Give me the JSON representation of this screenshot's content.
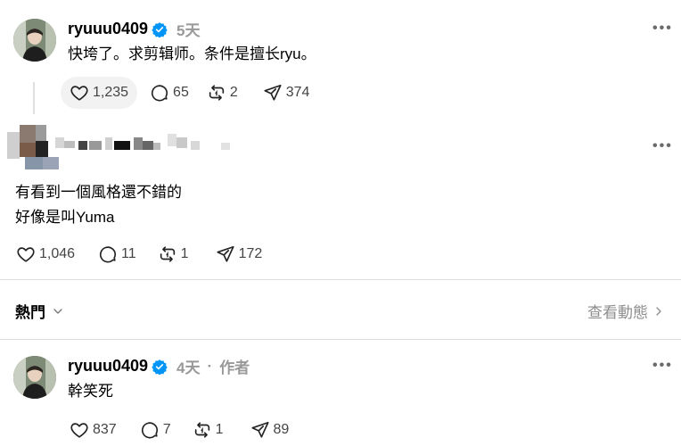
{
  "post1": {
    "username": "ryuuu0409",
    "time": "5天",
    "text": "快垮了。求剪辑师。条件是擅长ryu。",
    "likes": "1,235",
    "comments": "65",
    "reposts": "2",
    "shares": "374"
  },
  "post2": {
    "text_line1": "有看到一個風格還不錯的",
    "text_line2": "好像是叫Yuma",
    "likes": "1,046",
    "comments": "11",
    "reposts": "1",
    "shares": "172"
  },
  "section": {
    "label": "熱門",
    "more_label": "查看動態"
  },
  "post3": {
    "username": "ryuuu0409",
    "time": "4天",
    "separator": "·",
    "author_tag": "作者",
    "text": "幹笑死",
    "likes": "837",
    "comments": "7",
    "reposts": "1",
    "shares": "89"
  },
  "icons": {
    "more": "more-icon",
    "verified": "verified-badge-icon",
    "like": "heart-icon",
    "comment": "comment-icon",
    "repost": "repost-icon",
    "share": "share-icon",
    "chevron_down": "chevron-down-icon",
    "chevron_right": "chevron-right-icon"
  },
  "colors": {
    "verified": "#0095f6",
    "muted": "#999999",
    "divider": "#dcdcdc"
  }
}
